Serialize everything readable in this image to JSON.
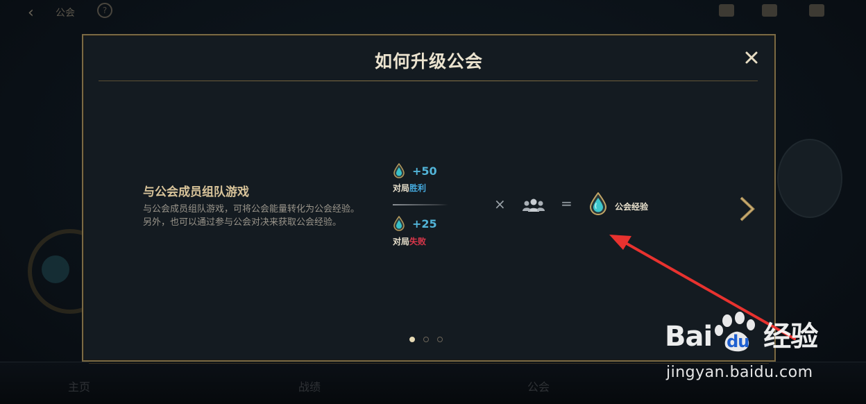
{
  "background": {
    "top_title": "公会",
    "help_icon": "?",
    "bottom_tabs": [
      "主页",
      "战绩",
      "公会"
    ]
  },
  "modal": {
    "title": "如何升级公会",
    "close_icon": "close-icon",
    "section_title": "与公会成员组队游戏",
    "section_desc": "与公会成员组队游戏，可将公会能量转化为公会经验。另外，也可以通过参与公会对决来获取公会经验。",
    "win_value": "+50",
    "win_label_prefix": "对局",
    "win_label_suffix": "胜利",
    "lose_value": "+25",
    "lose_label_prefix": "对局",
    "lose_label_suffix": "失败",
    "multiply": "×",
    "equals": "=",
    "result_label": "公会经验",
    "pagination": {
      "total": 3,
      "active": 0
    }
  },
  "watermark": {
    "brand_left": "Bai",
    "brand_right": "du",
    "brand_cn": "经验",
    "url": "jingyan.baidu.com"
  },
  "colors": {
    "accent_gold": "#c9aa71",
    "win_blue": "#45a9dd",
    "lose_red": "#d8364a",
    "arrow_red": "#e8322f"
  }
}
